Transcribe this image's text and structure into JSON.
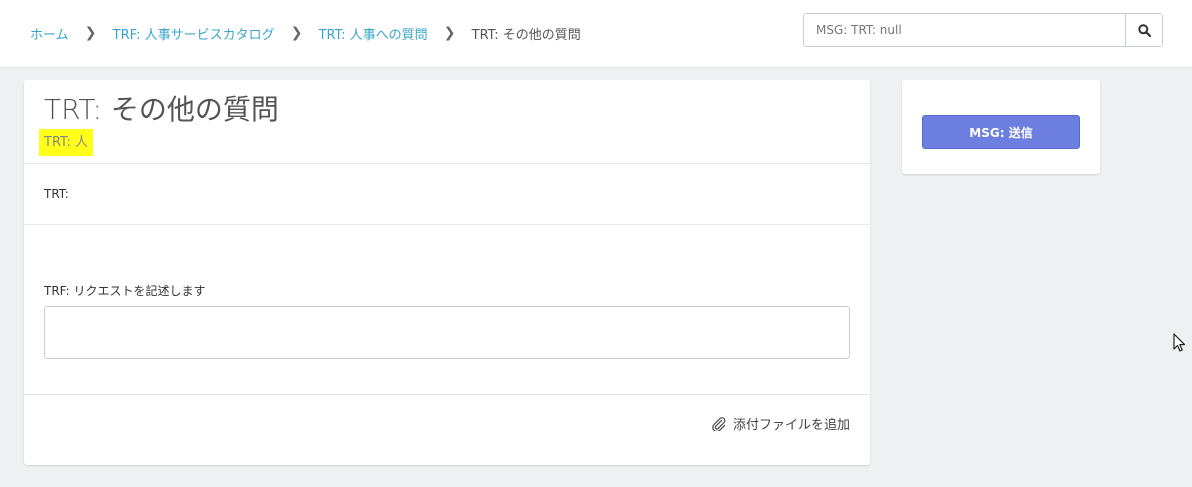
{
  "breadcrumb": {
    "home": "ホーム",
    "catalog": "TRF: 人事サービスカタログ",
    "category": "TRT: 人事への質問",
    "current": "TRT: その他の質問"
  },
  "search": {
    "placeholder": "MSG: TRT: null"
  },
  "item": {
    "title": "TRT: その他の質問",
    "tag": "TRT: 人",
    "description_label": "TRT:",
    "field_label": "TRF: リクエストを記述します",
    "field_value": "",
    "attach_label": "添付ファイルを追加"
  },
  "order": {
    "submit_label": "MSG: 送信"
  },
  "colors": {
    "link": "#3aa5c9",
    "highlight": "#ffff1a",
    "submit": "#6c7fe0"
  }
}
